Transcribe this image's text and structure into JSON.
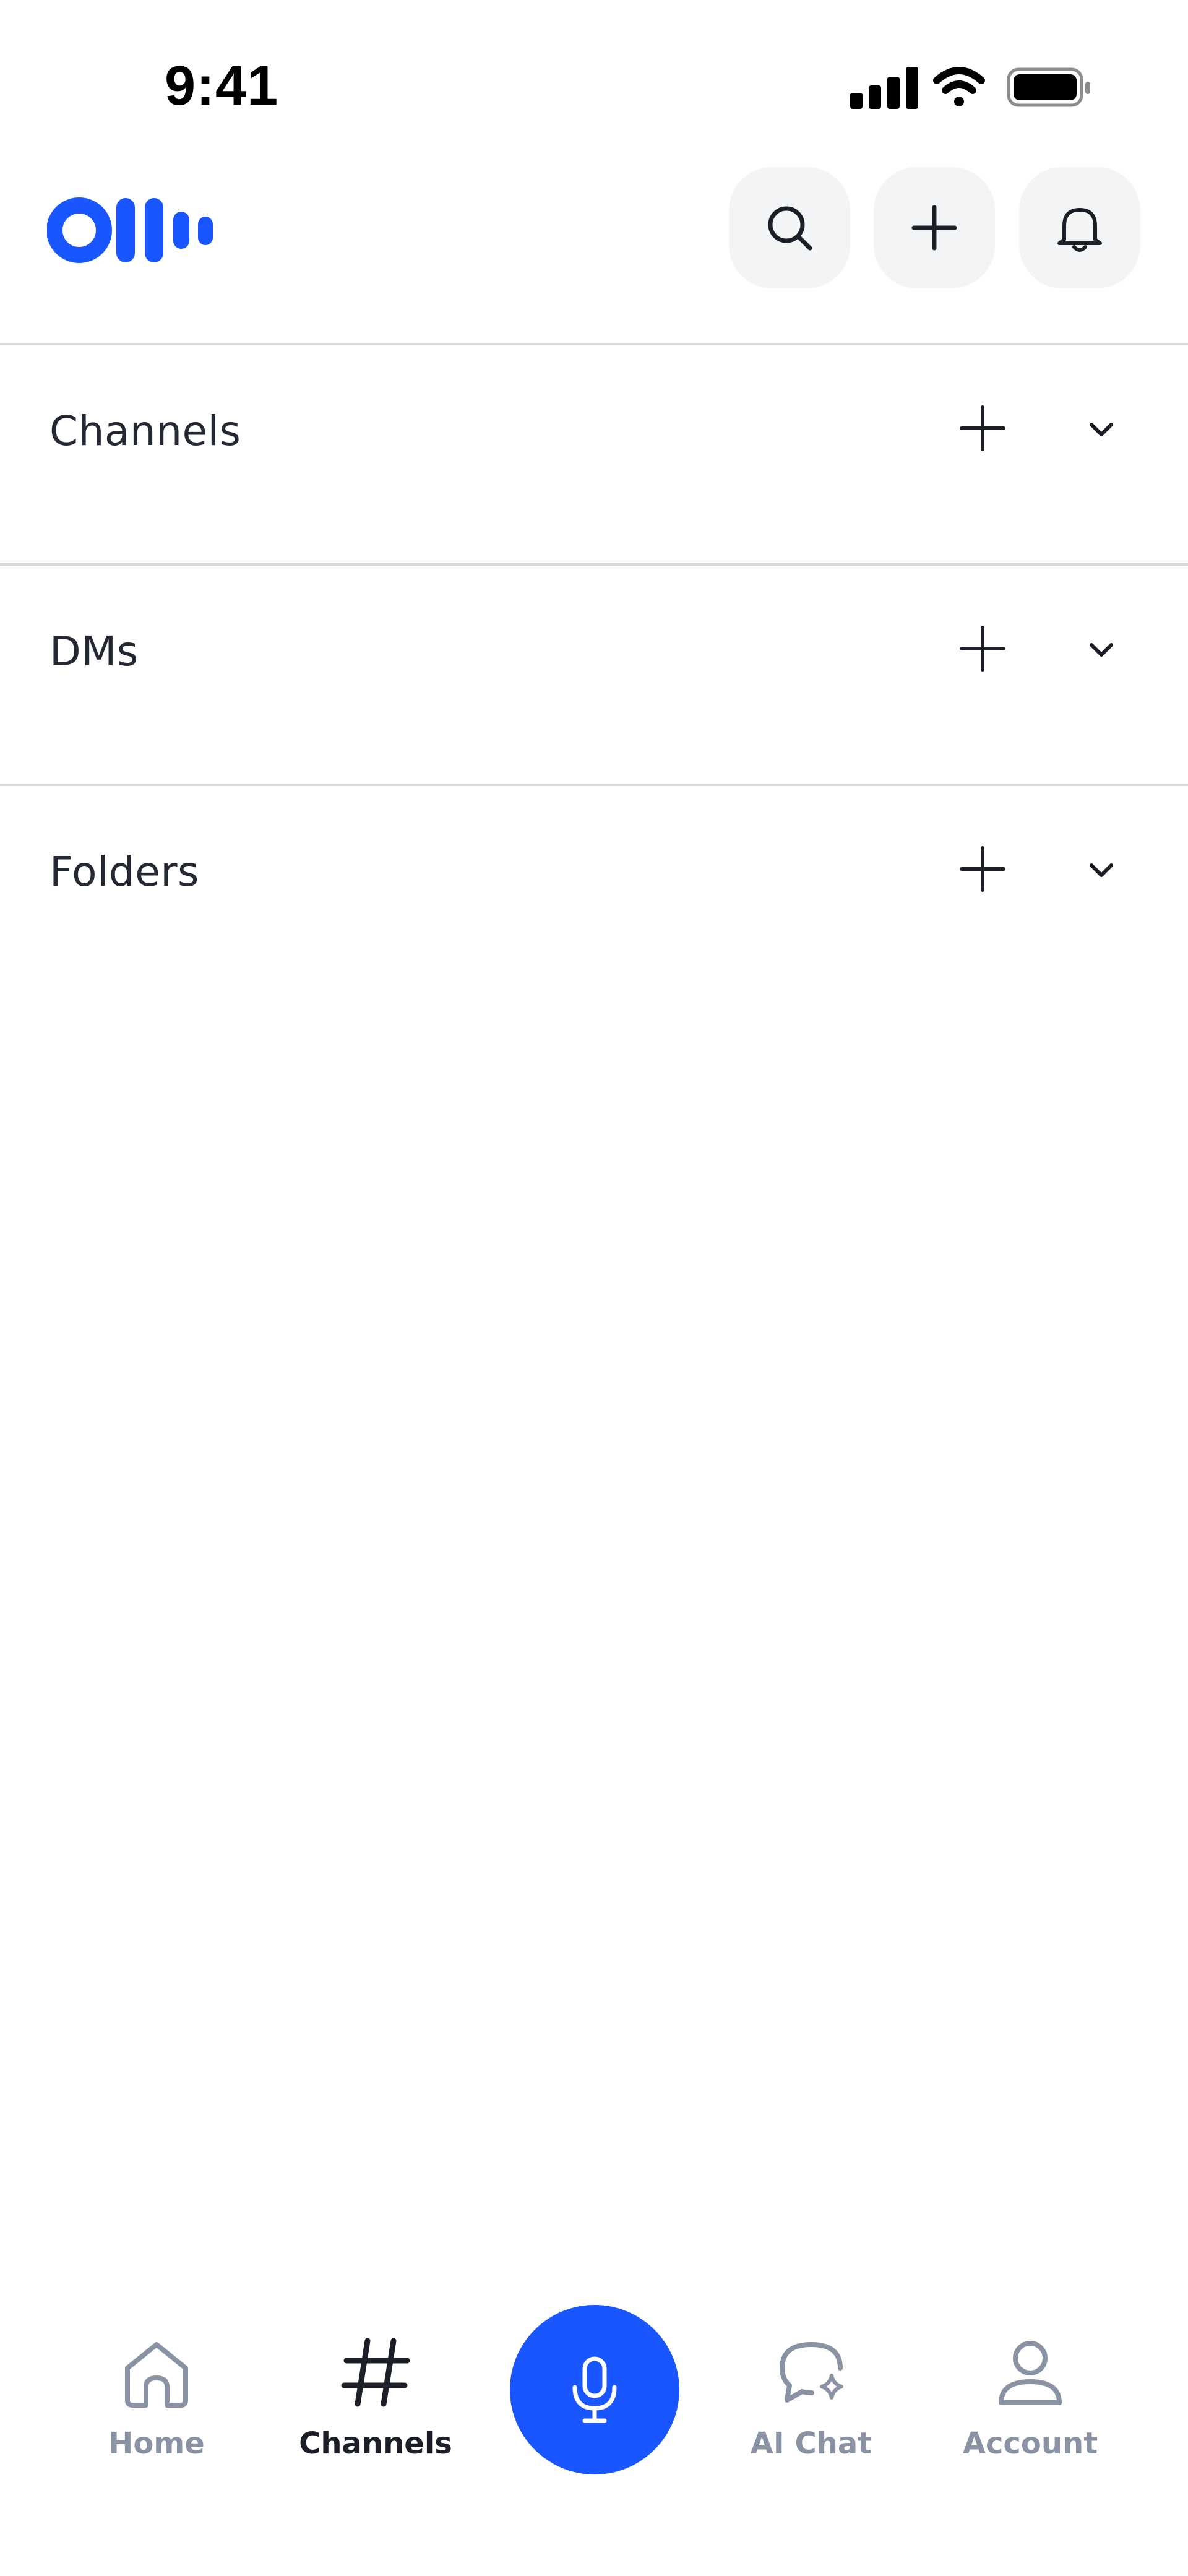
{
  "status_bar": {
    "time": "9:41"
  },
  "header": {
    "logo_icon": "otter-logo-icon",
    "buttons": [
      {
        "icon": "search-icon"
      },
      {
        "icon": "plus-icon"
      },
      {
        "icon": "bell-icon"
      }
    ]
  },
  "sections": [
    {
      "title": "Channels",
      "add_icon": "plus-icon",
      "toggle_icon": "chevron-down-icon"
    },
    {
      "title": "DMs",
      "add_icon": "plus-icon",
      "toggle_icon": "chevron-down-icon"
    },
    {
      "title": "Folders",
      "add_icon": "plus-icon",
      "toggle_icon": "chevron-down-icon"
    }
  ],
  "tab_bar": {
    "tabs": [
      {
        "label": "Home",
        "icon": "home-icon",
        "active": false
      },
      {
        "label": "Channels",
        "icon": "hash-icon",
        "active": true
      },
      {
        "label": "AI Chat",
        "icon": "ai-chat-icon",
        "active": false
      },
      {
        "label": "Account",
        "icon": "user-icon",
        "active": false
      }
    ],
    "record_button_icon": "microphone-icon"
  },
  "colors": {
    "brand_blue": "#1a56ff",
    "header_button_bg": "#f3f4f6",
    "divider": "#d6d9df",
    "text_primary": "#232833",
    "tab_inactive": "#8a93a3",
    "tab_active": "#1c1f28"
  }
}
